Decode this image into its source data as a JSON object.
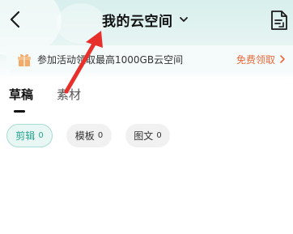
{
  "header": {
    "title": "我的云空间",
    "back_icon": "chevron-left-icon",
    "title_icon": "chevron-down-icon",
    "right_icon": "document-icon"
  },
  "promo": {
    "icon": "gift-icon",
    "text": "参加活动领取最高1000GB云空间",
    "link_label": "免费领取",
    "link_color": "#ec6a3c"
  },
  "tabs": [
    {
      "label": "草稿",
      "active": true
    },
    {
      "label": "素材",
      "active": false
    }
  ],
  "filters": [
    {
      "label": "剪辑",
      "count": "0",
      "selected": true
    },
    {
      "label": "模板",
      "count": "0",
      "selected": false
    },
    {
      "label": "图文",
      "count": "0",
      "selected": false
    }
  ],
  "colors": {
    "accent": "#2aa590",
    "promo_link": "#ec6a3c",
    "annotation_arrow": "#e8302a"
  }
}
